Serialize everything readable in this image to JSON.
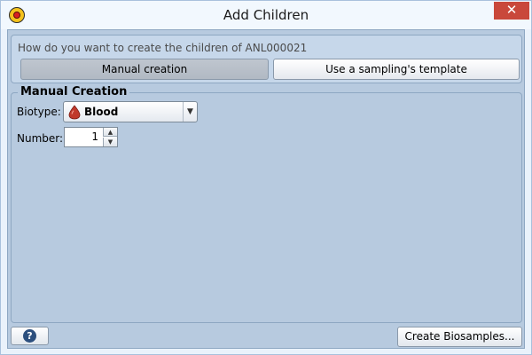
{
  "window": {
    "title": "Add Children",
    "close_glyph": "✕",
    "icon": "app-icon"
  },
  "mode": {
    "question": "How do you want to create the children of ANL000021",
    "manual_label": "Manual creation",
    "template_label": "Use a sampling's template",
    "selected": "Manual creation"
  },
  "manual": {
    "group_title": "Manual Creation",
    "biotype_label": "Biotype:",
    "biotype_value": "Blood",
    "biotype_icon": "blood-drop-icon",
    "number_label": "Number:",
    "number_value": "1"
  },
  "footer": {
    "help_glyph": "?",
    "create_label": "Create Biosamples..."
  },
  "colors": {
    "accent_close": "#c9483b",
    "panel": "#b7cadf",
    "blood": "#c0392b"
  }
}
